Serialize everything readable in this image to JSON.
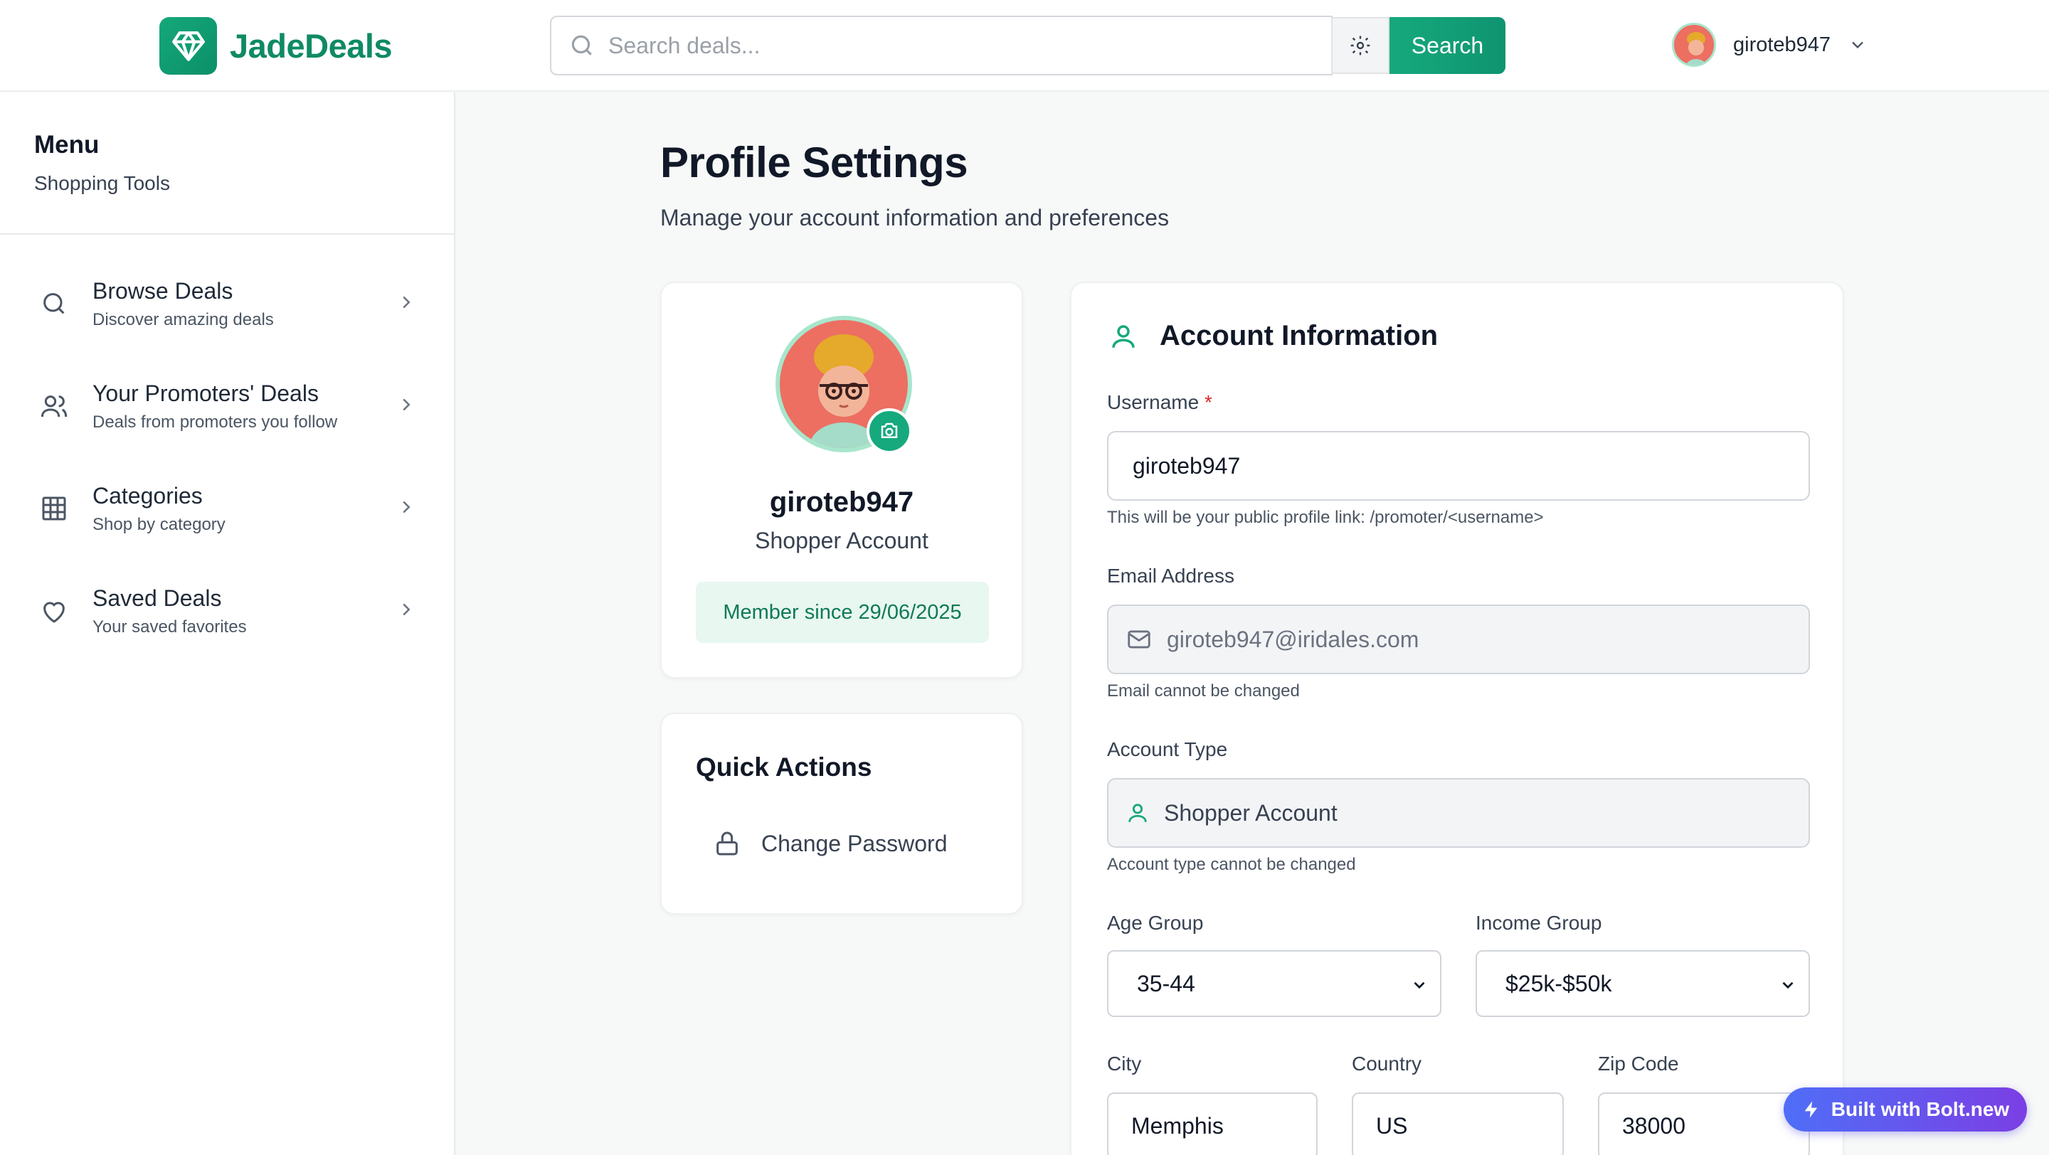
{
  "app": {
    "name": "JadeDeals",
    "brand_color": "#0f8a64"
  },
  "header": {
    "search_placeholder": "Search deals...",
    "search_button": "Search",
    "username": "giroteb947"
  },
  "sidebar": {
    "title": "Menu",
    "subtitle": "Shopping Tools",
    "items": [
      {
        "label": "Browse Deals",
        "desc": "Discover amazing deals",
        "icon": "search-icon"
      },
      {
        "label": "Your Promoters' Deals",
        "desc": "Deals from promoters you follow",
        "icon": "users-icon"
      },
      {
        "label": "Categories",
        "desc": "Shop by category",
        "icon": "grid-icon"
      },
      {
        "label": "Saved Deals",
        "desc": "Your saved favorites",
        "icon": "heart-icon"
      }
    ]
  },
  "page": {
    "title": "Profile Settings",
    "subtitle": "Manage your account information and preferences"
  },
  "profile": {
    "name": "giroteb947",
    "type": "Shopper Account",
    "member_since": "Member since 29/06/2025"
  },
  "quick_actions": {
    "title": "Quick Actions",
    "change_password": "Change Password"
  },
  "account": {
    "title": "Account Information",
    "username_label": "Username",
    "username_required": "*",
    "username_value": "giroteb947",
    "username_help": "This will be your public profile link: /promoter/<username>",
    "email_label": "Email Address",
    "email_value": "giroteb947@iridales.com",
    "email_help": "Email cannot be changed",
    "type_label": "Account Type",
    "type_value": "Shopper Account",
    "type_help": "Account type cannot be changed",
    "age_label": "Age Group",
    "age_value": "35-44",
    "income_label": "Income Group",
    "income_value": "$25k-$50k",
    "city_label": "City",
    "city_value": "Memphis",
    "country_label": "Country",
    "country_value": "US",
    "zip_label": "Zip Code",
    "zip_value": "38000"
  },
  "badge": {
    "label": "Built with Bolt.new"
  }
}
